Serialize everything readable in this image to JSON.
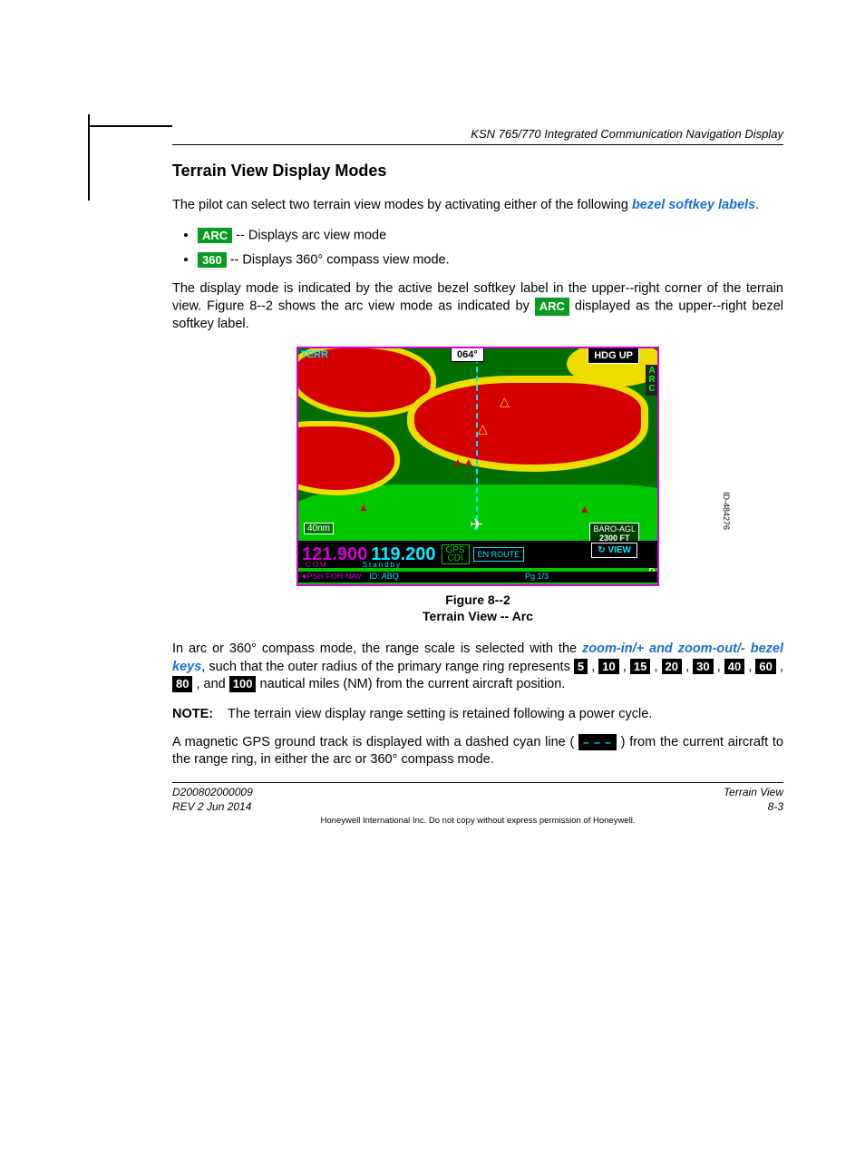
{
  "header": {
    "title": "KSN 765/770 Integrated Communication Navigation Display"
  },
  "section": {
    "heading": "Terrain View Display Modes"
  },
  "intro": {
    "p1a": "The pilot can select two terrain view modes by activating either of the following ",
    "link1": "bezel softkey labels",
    "p1b": "."
  },
  "list": {
    "arc": {
      "pill": "ARC",
      "text": " -- Displays arc view mode"
    },
    "c360": {
      "pill": "360",
      "text": " -- Displays 360° compass view mode."
    }
  },
  "para2a": "The display mode is indicated by the active bezel softkey label in the upper--right corner of the terrain view. Figure 8--2 shows the arc view mode as indicated by ",
  "para2pill": "ARC",
  "para2b": " displayed as the upper--right bezel softkey label.",
  "figure": {
    "terr": "TERR",
    "heading": "064°",
    "hdgup": "HDG UP",
    "arc_side": "A\nR\nC",
    "lgnd_side": "L\nG\nN\nD",
    "range": "40nm",
    "baro1": "BARO-AGL",
    "baro2": "2300 FT",
    "freq_active": "121.900",
    "freq_standby": "119.200",
    "com": "COM",
    "standby": "Standby",
    "gps1": "GPS",
    "gps2": "CDI",
    "enroute": "EN ROUTE",
    "view": "↻ VIEW",
    "psh": "●PSH FOR NAV",
    "id": "ID: ABQ",
    "pg": "Pg 1/3",
    "idtag": "ID-484276"
  },
  "caption": {
    "l1": "Figure 8--2",
    "l2": "Terrain View -- Arc"
  },
  "para3": {
    "a": "In arc or 360° compass mode, the range scale is selected with the ",
    "link": "zoom-in/+ and zoom-out/- bezel keys",
    "b": ", such that the outer radius of the primary range ring represents ",
    "r5": "5",
    "r10": "10",
    "r15": "15",
    "r20": "20",
    "r30": "30",
    "r40": "40",
    "r60": "60",
    "r80": "80",
    "r100": "100",
    "c": " nautical miles (NM) from the current aircraft position."
  },
  "note": {
    "label": "NOTE:",
    "text": "The terrain view display range setting is retained following a power cycle."
  },
  "para4": {
    "a": "A magnetic GPS ground track is displayed with a dashed cyan line ( ",
    "dash": "– – –",
    "b": " ) from the current aircraft to the range ring, in either the arc or 360° compass mode."
  },
  "footer": {
    "doc": "D200802000009",
    "rev": "REV 2   Jun 2014",
    "section": "Terrain View",
    "page": "8-3",
    "copyright": "Honeywell International Inc. Do not copy without express permission of Honeywell."
  }
}
